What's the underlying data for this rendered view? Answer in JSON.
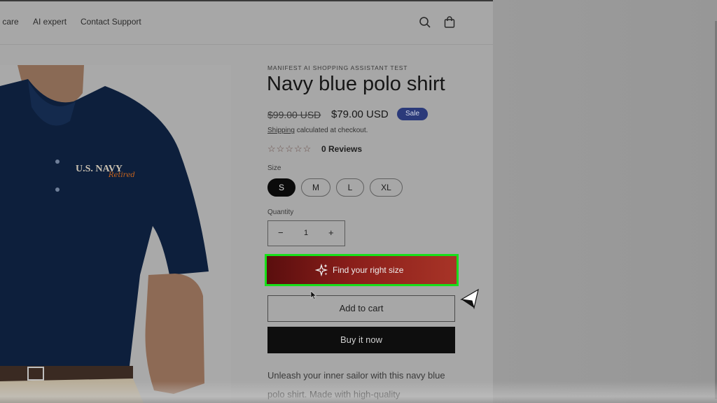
{
  "nav": {
    "care": "r care",
    "ai_expert": "AI expert",
    "contact": "Contact Support"
  },
  "header": {
    "icons": [
      "search-icon",
      "cart-icon"
    ]
  },
  "product": {
    "vendor": "MANIFEST AI SHOPPING ASSISTANT TEST",
    "title": "Navy blue polo shirt",
    "compare_price": "$99.00 USD",
    "price": "$79.00 USD",
    "badge": "Sale",
    "shipping_link": "Shipping",
    "shipping_rest": " calculated at checkout.",
    "stars": "☆☆☆☆☆",
    "reviews": "0 Reviews",
    "size_label": "Size",
    "sizes": [
      "S",
      "M",
      "L",
      "XL"
    ],
    "selected_size": "S",
    "quantity_label": "Quantity",
    "quantity": "1",
    "minus": "−",
    "plus": "+",
    "find_size": "Find your right size",
    "add_to_cart": "Add to cart",
    "buy_now": "Buy it now",
    "description": "Unleash your inner sailor with this navy blue polo shirt. Made with high-quality",
    "shirt_text": "U.S. NAVY",
    "shirt_script": "Retired"
  },
  "colors": {
    "highlight": "#17e01b",
    "find_size_bg": "#8a1e1a",
    "badge": "#2b3a7a",
    "shirt": "#0d1f3c"
  }
}
